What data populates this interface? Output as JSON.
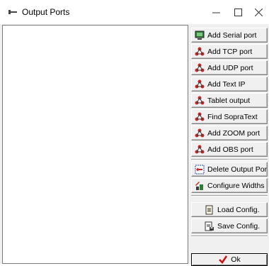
{
  "window": {
    "title": "Output Ports",
    "controls": {
      "minimize": "—",
      "maximize": "☐",
      "close": "✕"
    }
  },
  "buttons": [
    {
      "label": "Add Serial port",
      "icon": "monitor-icon"
    },
    {
      "label": "Add TCP port",
      "icon": "network-icon"
    },
    {
      "label": "Add UDP port",
      "icon": "network-icon"
    },
    {
      "label": "Add Text IP",
      "icon": "network-icon"
    },
    {
      "label": "Tablet output",
      "icon": "network-icon"
    },
    {
      "label": "Find SopraText",
      "icon": "network-icon"
    },
    {
      "label": "Add ZOOM port",
      "icon": "network-icon"
    },
    {
      "label": "Add OBS port",
      "icon": "network-icon"
    },
    {
      "label": "Delete Output Port",
      "icon": "delete-port-icon"
    },
    {
      "label": "Configure Widths",
      "icon": "configure-icon"
    },
    {
      "label": "Load Config.",
      "icon": "load-doc-icon"
    },
    {
      "label": "Save Config.",
      "icon": "save-doc-icon"
    },
    {
      "label": "Ok",
      "icon": "checkmark-icon"
    }
  ],
  "colors": {
    "checkmark": "#d01010",
    "monitor": "#2e7d32",
    "network_red": "#c62828",
    "network_dark": "#3a3a3a"
  }
}
